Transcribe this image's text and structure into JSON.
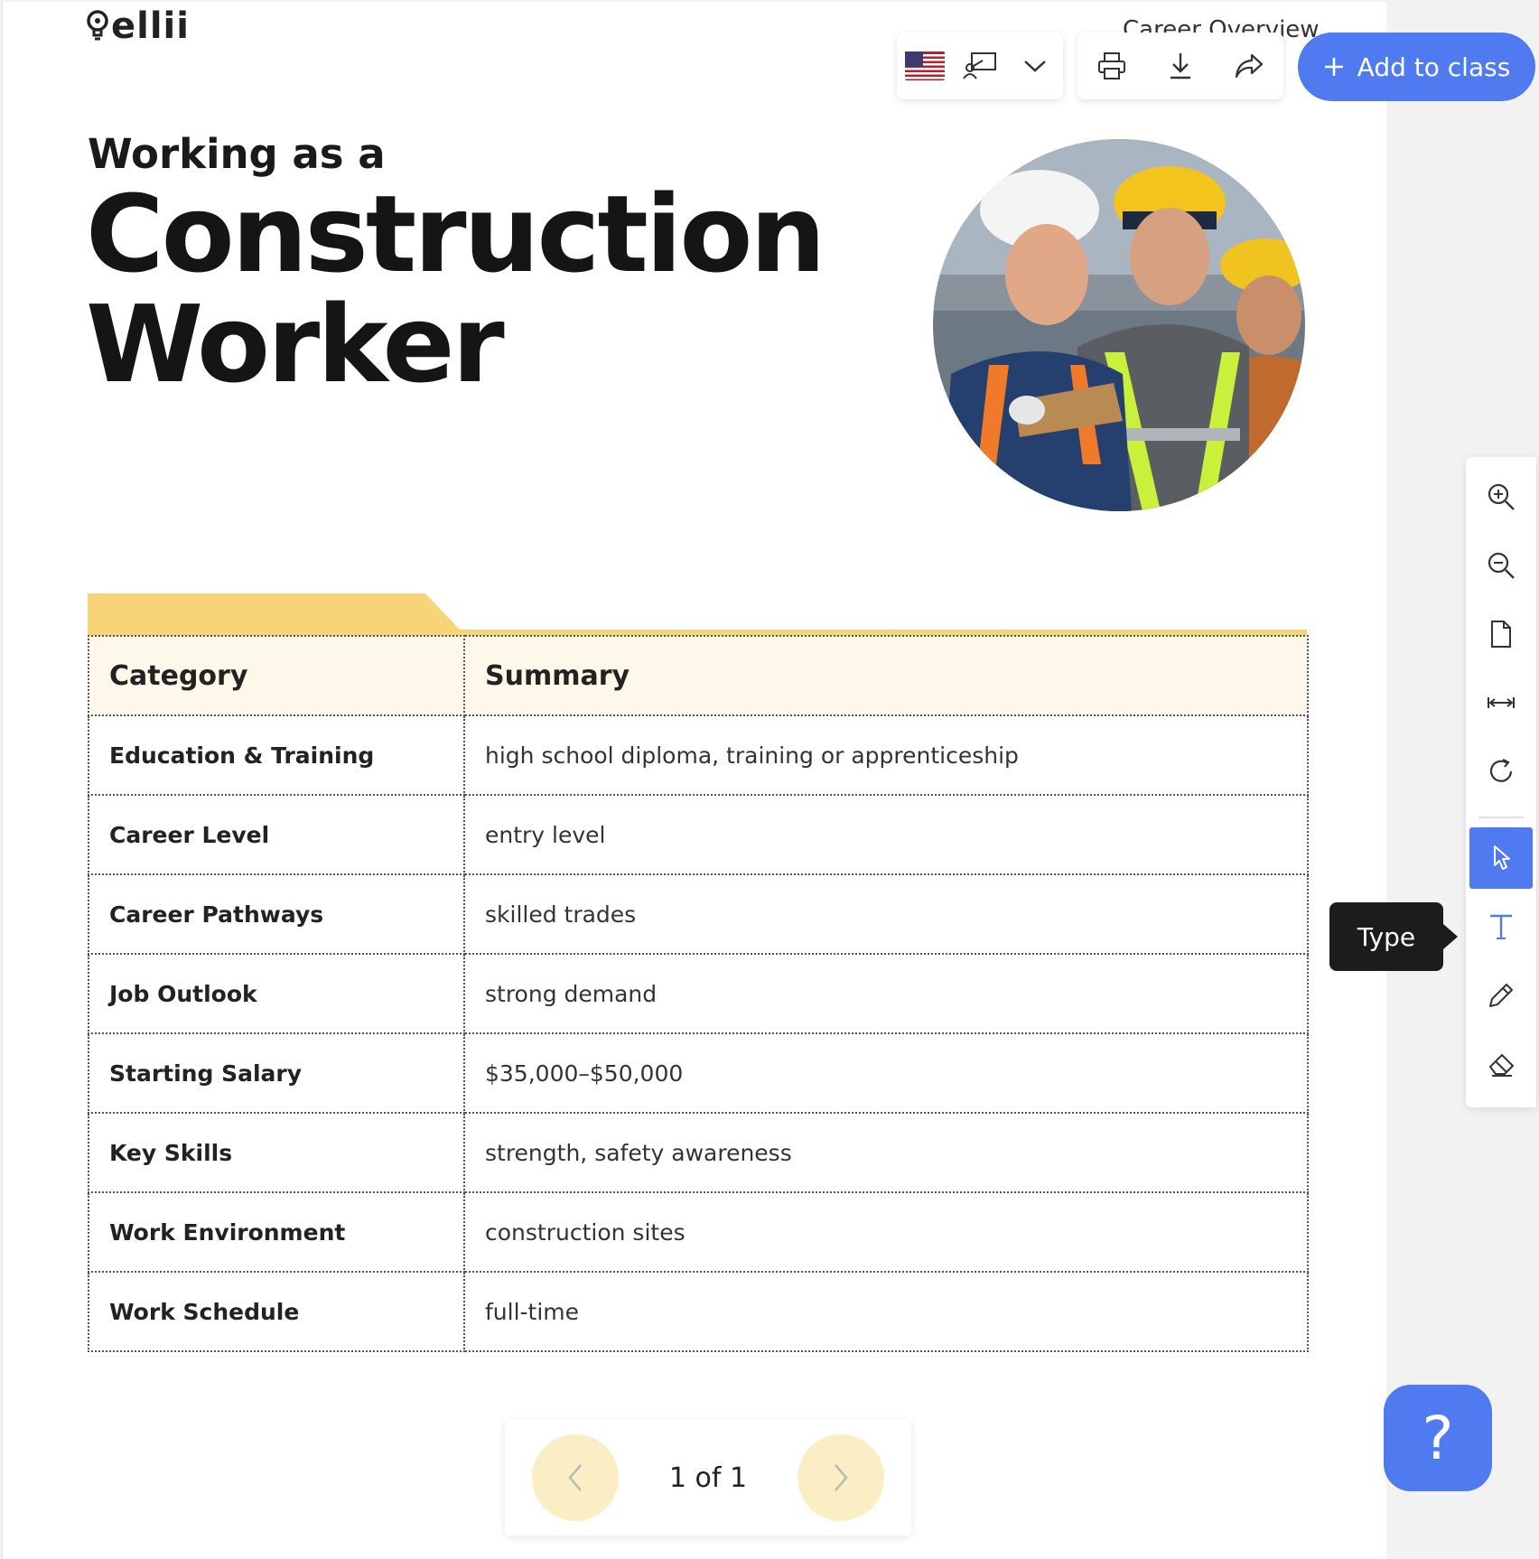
{
  "brand": {
    "logo_text": "ellii"
  },
  "header": {
    "breadcrumb": "Career Overview"
  },
  "toolbar": {
    "language_flag": "us-flag-icon",
    "add_to_class_label": "Add to class"
  },
  "document": {
    "subtitle": "Working as a",
    "title_line1": "Construction",
    "title_line2": "Worker",
    "table": {
      "headers": [
        "Category",
        "Summary"
      ],
      "rows": [
        {
          "category": "Education & Training",
          "summary": "high school diploma, training or apprenticeship"
        },
        {
          "category": "Career Level",
          "summary": "entry level"
        },
        {
          "category": "Career Pathways",
          "summary": "skilled trades"
        },
        {
          "category": "Job Outlook",
          "summary": "strong demand"
        },
        {
          "category": "Starting Salary",
          "summary": "$35,000–$50,000"
        },
        {
          "category": "Key Skills",
          "summary": "strength, safety awareness"
        },
        {
          "category": "Work Environment",
          "summary": "construction sites"
        },
        {
          "category": "Work Schedule",
          "summary": "full-time"
        }
      ]
    }
  },
  "pager": {
    "label": "1 of 1"
  },
  "side_tools": {
    "tooltip": "Type"
  },
  "help": {
    "label": "?"
  },
  "colors": {
    "accent": "#4f7af0",
    "tab_yellow": "#f8d478",
    "pager_yellow": "#fbeec4",
    "header_cell": "#fdf8ea"
  }
}
